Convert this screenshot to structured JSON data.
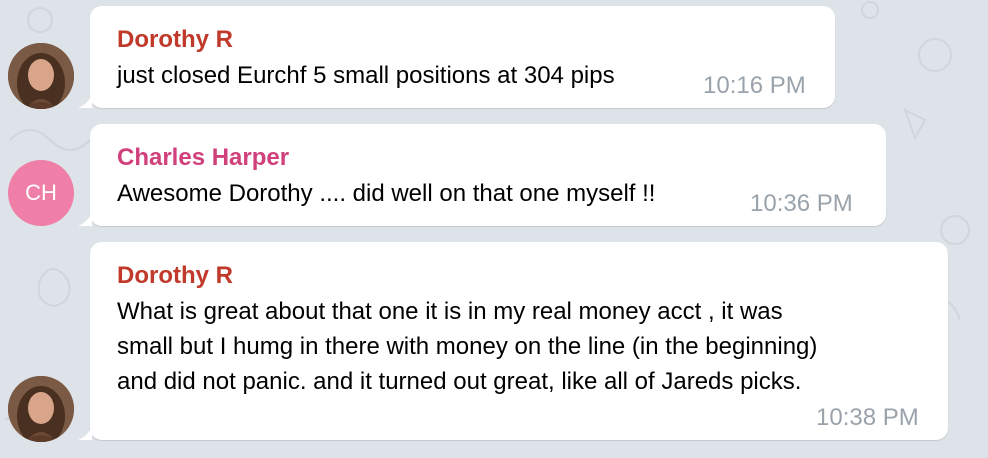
{
  "theme": {
    "chat_background": "#dde3e8",
    "bubble_color": "#ffffff",
    "dorothy_name_color": "#c0392b",
    "charles_name_color": "#d0407a",
    "timestamp_color": "#9aa3ab",
    "charles_avatar_color": "#ef7fa7"
  },
  "messages": [
    {
      "sender": "Dorothy R",
      "avatar_type": "photo",
      "lines": [
        "just closed Eurchf 5 small positions at 304 pips"
      ],
      "time": "10:16 PM"
    },
    {
      "sender": "Charles Harper",
      "avatar_type": "initials",
      "initials": "CH",
      "lines": [
        "Awesome Dorothy .... did well on that one myself !!"
      ],
      "time": "10:36 PM"
    },
    {
      "sender": "Dorothy R",
      "avatar_type": "photo",
      "lines": [
        "What is great about that one it is in my real money acct , it was",
        "small but I humg in there with money on the line (in the beginning)",
        "and did not panic. and it turned out great, like all of Jareds picks."
      ],
      "time": "10:38 PM"
    }
  ]
}
